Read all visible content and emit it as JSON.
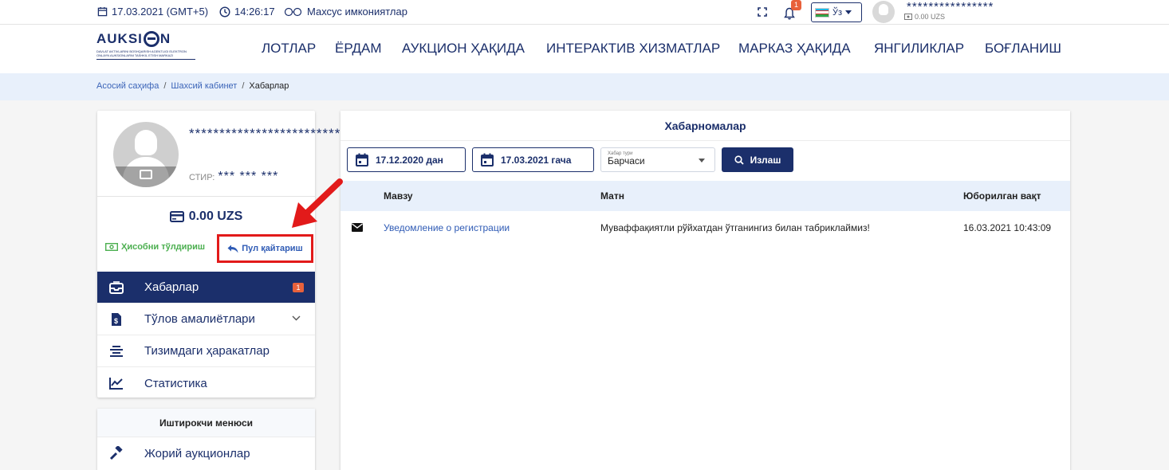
{
  "topbar": {
    "date": "17.03.2021 (GMT+5)",
    "time": "14:26:17",
    "accessibility": "Махсус имкониятлар",
    "notification_count": "1",
    "language": "Ўз",
    "user_name": "****************",
    "user_balance": "0.00 UZS",
    "icons": [
      "calendar-icon",
      "clock-icon",
      "glasses-icon",
      "fullscreen-icon",
      "bell-icon",
      "flag-uz-icon",
      "chevron-down-icon",
      "avatar",
      "wallet-icon"
    ]
  },
  "logo": {
    "text_left": "AUKSI",
    "text_right": "N",
    "subtitle": "DAVLAT AKTIVLARINI BOSHQARISH AGENTLIGI ELEKTRON ONLAYN AUKSIONLARNI TASHKIL ETISH MARKAZI"
  },
  "nav": {
    "items": [
      "ЛОТЛАР",
      "ЁРДАМ",
      "АУКЦИОН ҲАҚИДА",
      "ИНТЕРАКТИВ ХИЗМАТЛАР",
      "МАРКАЗ ҲАҚИДА",
      "ЯНГИЛИКЛАР",
      "БОҒЛАНИШ"
    ]
  },
  "breadcrumb": {
    "home": "Асосий саҳифа",
    "cabinet": "Шахсий кабинет",
    "current": "Хабарлар",
    "separator": "/"
  },
  "profile": {
    "name": "*************************************",
    "stir_label": "СТИР:",
    "stir_value": "*** *** ***",
    "balance": "0.00 UZS",
    "fill_account": "Ҳисобни тўлдириш",
    "refund": "Пул қайтариш",
    "highlight_color": "#e21a1a"
  },
  "menu": {
    "items": [
      {
        "label": "Хабарлар",
        "icon": "inbox-icon",
        "badge": "1",
        "active": true
      },
      {
        "label": "Тўлов амалиётлари",
        "icon": "invoice-icon",
        "expandable": true
      },
      {
        "label": "Тизимдаги ҳаракатлар",
        "icon": "list-icon"
      },
      {
        "label": "Статистика",
        "icon": "chart-icon"
      }
    ]
  },
  "participant_menu": {
    "title": "Иштирокчи менюси",
    "items": [
      {
        "label": "Жорий аукционлар",
        "icon": "gavel-icon"
      }
    ]
  },
  "notifications": {
    "title": "Хабарномалар",
    "date_from": "17.12.2020 дан",
    "date_to": "17.03.2021 гача",
    "type_label": "Хабар тури",
    "type_value": "Барчаси",
    "search": "Излаш",
    "columns": {
      "subject": "Мавзу",
      "text": "Матн",
      "sent_time": "Юборилган вақт"
    },
    "rows": [
      {
        "icon": "envelope-icon",
        "subject": "Уведомление о регистрации",
        "text": "Муваффақиятли рўйхатдан ўтганингиз билан табриклаймиз!",
        "sent_time": "16.03.2021 10:43:09"
      }
    ]
  },
  "colors": {
    "primary": "#1b2f6b",
    "accent_link": "#2f5bb5",
    "badge": "#e8613b",
    "success": "#4caf50",
    "annotation": "#e21a1a"
  }
}
